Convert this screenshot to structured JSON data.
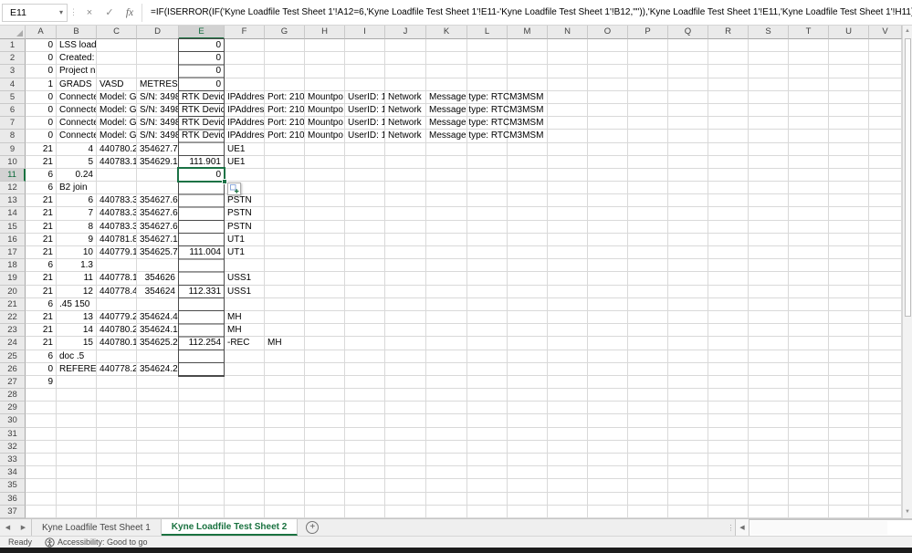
{
  "colors": {
    "accent_green": "#1A7240",
    "selection_border": "#1B7245",
    "header_bg": "#EAEAEA",
    "header_selected_bg": "#D2D2D2",
    "gridline": "#D9D9D9",
    "user_cell_border": "#4A4A4A",
    "active_tab_text": "#1A7240"
  },
  "formula_bar": {
    "name_box": "E11",
    "divider_dots": "⋮",
    "cancel_label": "×",
    "enter_label": "✓",
    "fx_label": "fx",
    "formula": "=IF(ISERROR(IF('Kyne Loadfile Test Sheet 1'!A12=6,'Kyne Loadfile Test Sheet 1'!E11-'Kyne Loadfile Test Sheet 1'!B12,\"\")),'Kyne Loadfile Test Sheet 1'!E11,'Kyne Loadfile Test Sheet 1'!H11)"
  },
  "icons": {
    "name_box_dropdown": "▾",
    "scroll_up": "▲",
    "scroll_down": "▼",
    "sheet_nav_left": "◀",
    "sheet_nav_right": "▶",
    "hscroll_left": "◀",
    "tab_splitter": "⋮"
  },
  "grid": {
    "columns": [
      "A",
      "B",
      "C",
      "D",
      "E",
      "F",
      "G",
      "H",
      "I",
      "J",
      "K",
      "L",
      "M",
      "N",
      "O",
      "P",
      "Q",
      "R",
      "S",
      "T",
      "U",
      "V"
    ],
    "rows": 37,
    "selected_cell": "E11",
    "selected_col": "E",
    "selected_row": 11,
    "bordered_column": "E",
    "bordered_row_range": [
      1,
      26
    ],
    "spill_cells": [
      "K5",
      "K6",
      "K7",
      "K8"
    ],
    "cells": {
      "A1": "0",
      "B1": "LSS load f",
      "E1": "0",
      "A2": "0",
      "B2": "Created: (",
      "E2": "0",
      "A3": "0",
      "B3": "Project na",
      "E3": "0",
      "A4": "1",
      "B4": "GRADS",
      "C4": "VASD",
      "D4": "METRES",
      "E4": "0",
      "A5": "0",
      "B5": "Connecte",
      "C5": "Model: G",
      "D5": "S/N: 3498",
      "E5": "RTK Device:",
      "F5": "IPAddres:",
      "G5": "Port: 2101",
      "H5": "Mountpo",
      "I5": "UserID: 1",
      "J5": "Network",
      "K5": "Message type: RTCM3MSM",
      "A6": "0",
      "B6": "Connecte",
      "C6": "Model: G",
      "D6": "S/N: 3498",
      "E6": "RTK Device:",
      "F6": "IPAddres:",
      "G6": "Port: 2101",
      "H6": "Mountpo",
      "I6": "UserID: 1",
      "J6": "Network",
      "K6": "Message type: RTCM3MSM",
      "A7": "0",
      "B7": "Connecte",
      "C7": "Model: G",
      "D7": "S/N: 3498",
      "E7": "RTK Device:",
      "F7": "IPAddres:",
      "G7": "Port: 2101",
      "H7": "Mountpo",
      "I7": "UserID: 1",
      "J7": "Network",
      "K7": "Message type: RTCM3MSM",
      "A8": "0",
      "B8": "Connecte",
      "C8": "Model: G",
      "D8": "S/N: 3498",
      "E8": "RTK Device:",
      "F8": "IPAddres:",
      "G8": "Port: 2101",
      "H8": "Mountpo",
      "I8": "UserID: 1",
      "J8": "Network",
      "K8": "Message type: RTCM3MSM",
      "A9": "21",
      "B9": "4",
      "C9": "440780.2",
      "D9": "354627.7",
      "F9": "UE1",
      "A10": "21",
      "B10": "5",
      "C10": "440783.1",
      "D10": "354629.1",
      "E10": "111.901",
      "F10": "UE1",
      "A11": "6",
      "B11": "0.24",
      "E11": "0",
      "A12": "6",
      "B12": "B2 join",
      "A13": "21",
      "B13": "6",
      "C13": "440783.3",
      "D13": "354627.6",
      "F13": "PSTN",
      "A14": "21",
      "B14": "7",
      "C14": "440783.3",
      "D14": "354627.6",
      "F14": "PSTN",
      "A15": "21",
      "B15": "8",
      "C15": "440783.3",
      "D15": "354627.6",
      "F15": "PSTN",
      "A16": "21",
      "B16": "9",
      "C16": "440781.8",
      "D16": "354627.1",
      "F16": "UT1",
      "A17": "21",
      "B17": "10",
      "C17": "440779.1",
      "D17": "354625.7",
      "E17": "111.004",
      "F17": "UT1",
      "A18": "6",
      "B18": "1.3",
      "A19": "21",
      "B19": "11",
      "C19": "440778.1",
      "D19": "354626",
      "F19": "USS1",
      "A20": "21",
      "B20": "12",
      "C20": "440778.4",
      "D20": "354624",
      "E20": "112.331",
      "F20": "USS1",
      "A21": "6",
      "B21": ".45 150",
      "A22": "21",
      "B22": "13",
      "C22": "440779.2",
      "D22": "354624.4",
      "F22": "MH",
      "A23": "21",
      "B23": "14",
      "C23": "440780.2",
      "D23": "354624.1",
      "F23": "MH",
      "A24": "21",
      "B24": "15",
      "C24": "440780.1",
      "D24": "354625.2",
      "E24": "112.254",
      "F24": "-REC",
      "G24": "MH",
      "A25": "6",
      "B25": "doc .5",
      "A26": "0",
      "B26": "REFERENC",
      "C26": "440778.2",
      "D26": "354624.2",
      "A27": "9"
    }
  },
  "sheet_tabs": {
    "tabs": [
      {
        "label": "Kyne Loadfile Test Sheet 1",
        "active": false
      },
      {
        "label": "Kyne Loadfile Test Sheet 2",
        "active": true
      }
    ],
    "add_label": "+"
  },
  "status_bar": {
    "ready": "Ready",
    "accessibility": "Accessibility: Good to go"
  }
}
